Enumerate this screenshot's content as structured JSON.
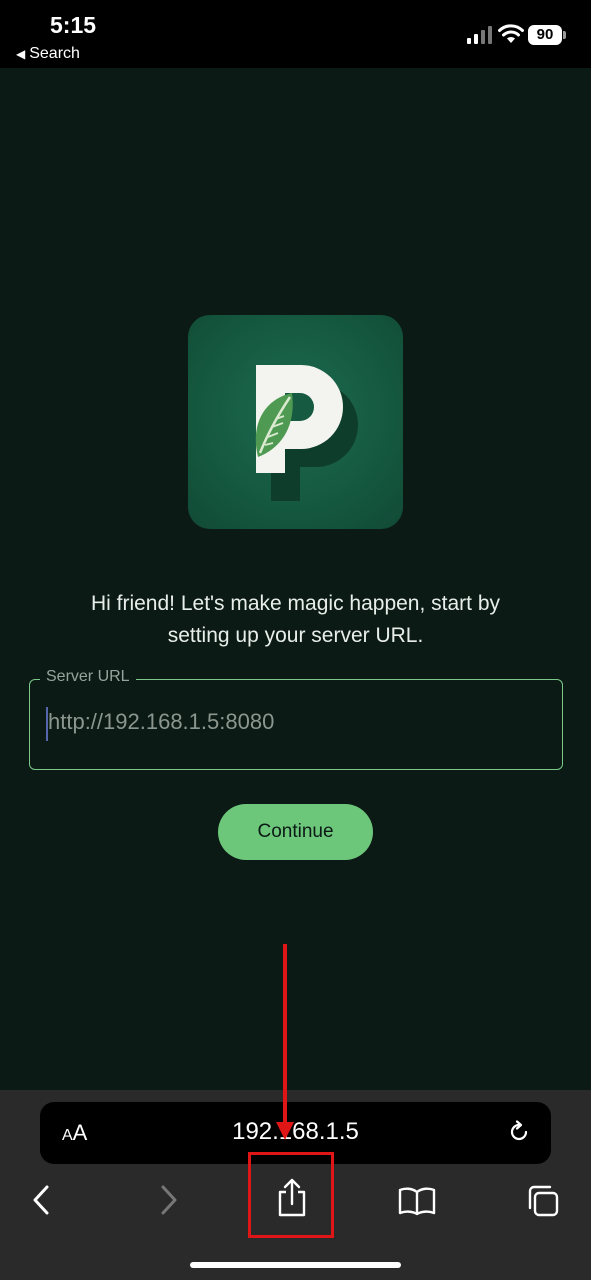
{
  "status_bar": {
    "time": "5:15",
    "back_label": "Search",
    "battery": "90"
  },
  "logo": {
    "letter": "P",
    "icon": "leaf-icon"
  },
  "intro": {
    "line1": "Hi friend! Let's make magic happen, start by",
    "line2": "setting up your server URL."
  },
  "server_url": {
    "label": "Server URL",
    "placeholder": "http://192.168.1.5:8080"
  },
  "continue_label": "Continue",
  "browser": {
    "aa_small": "A",
    "aa_large": "A",
    "address": "192.168.1.5"
  },
  "colors": {
    "background": "#0b1a15",
    "accent": "#6dc77a",
    "annotation": "#e01515"
  }
}
